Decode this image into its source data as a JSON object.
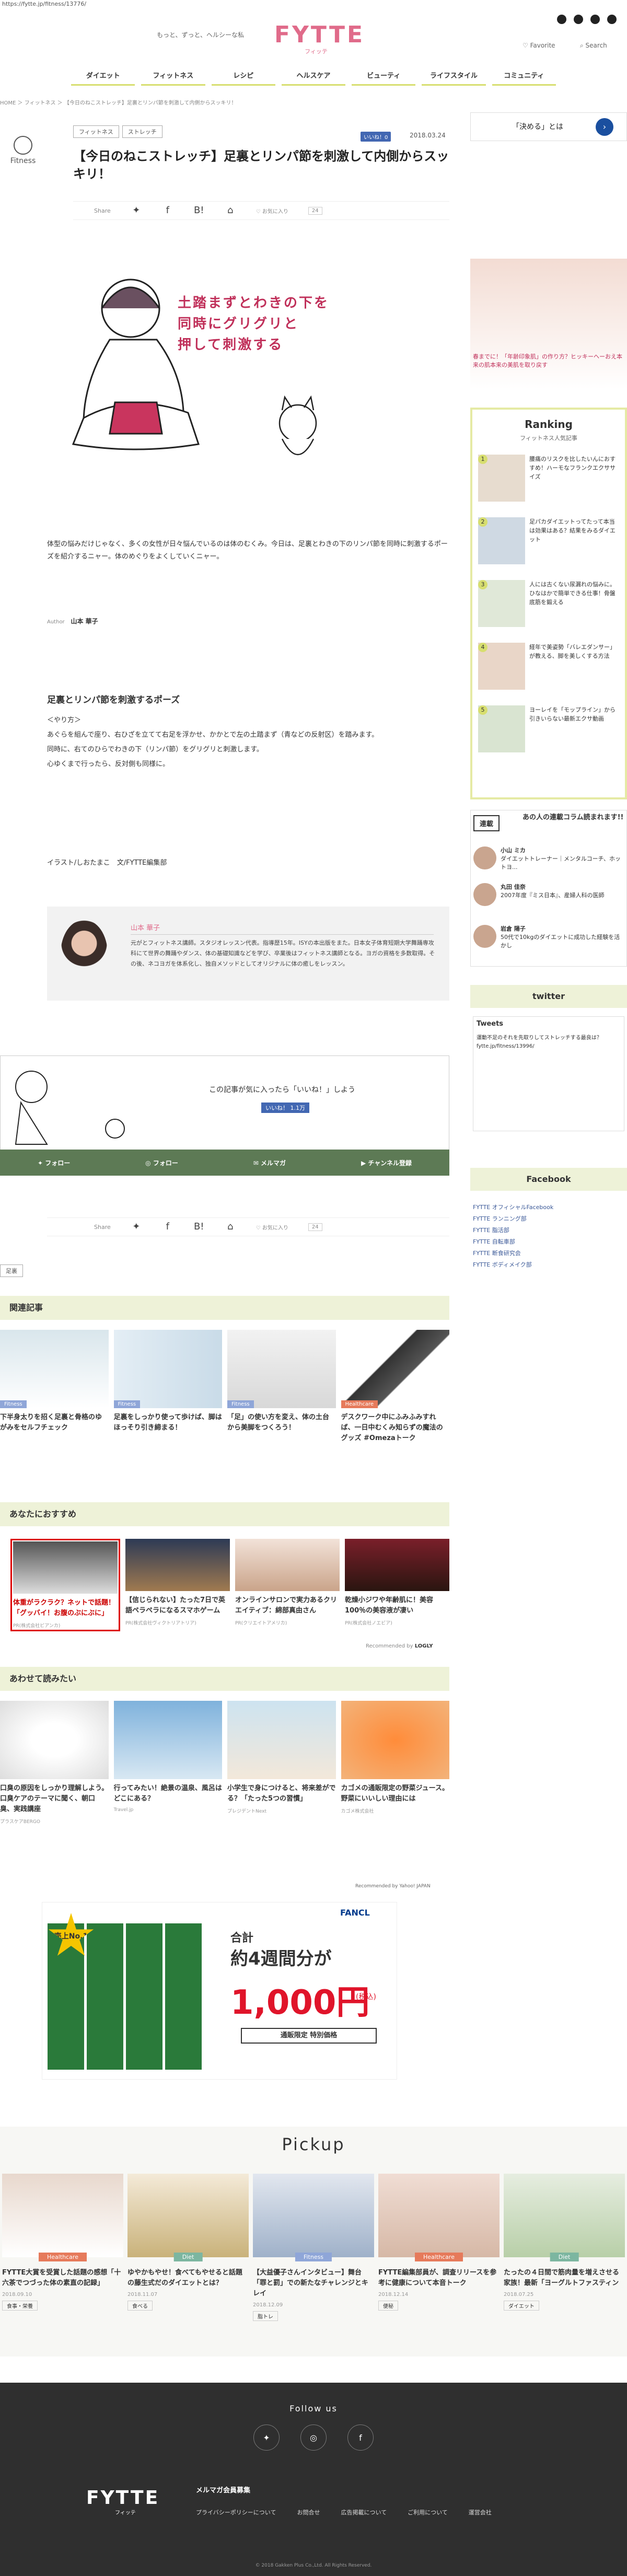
{
  "browser": {
    "url": "https://fytte.jp/fitness/13776/"
  },
  "header": {
    "tagline": "もっと、ずっと、ヘルシーな私",
    "logo": "FYTTE",
    "logo_sub": "フィッテ",
    "favorite": "Favorite",
    "search": "Search",
    "nav": [
      "ダイエット",
      "フィットネス",
      "レシピ",
      "ヘルスケア",
      "ビューティ",
      "ライフスタイル",
      "コミュニティ"
    ]
  },
  "breadcrumb": "HOME ＞ フィットネス ＞ 【今日のねこストレッチ】足裏とリンパ節を刺激して内側からスッキリ！",
  "article": {
    "category_label": "Fitness",
    "tags": [
      "フィットネス",
      "ストレッチ"
    ],
    "like_label": "いいね！0",
    "date": "2018.03.24",
    "title": "【今日のねこストレッチ】足裏とリンパ節を刺激して内側からスッキリ！",
    "share_label": "Share",
    "save_label": "お気に入り",
    "save_count": "24",
    "hero_text": [
      "土踏まずとわきの下を",
      "同時にグリグリと",
      "押して刺激する"
    ],
    "intro": "体型の悩みだけじゃなく、多くの女性が日々悩んでいるのは体のむくみ。今日は、足裏とわきの下のリンパ節を同時に刺激するポーズを紹介するニャー。体のめぐりをよくしていくニャー。",
    "author_label": "Author",
    "author_name": "山本 華子",
    "section_title": "足裏とリンパ節を刺激するポーズ",
    "method_title": "＜やり方＞",
    "method": [
      "あぐらを組んで座り、右ひざを立てて右足を浮かせ、かかとで左の土踏まず（青などの反射区）を踏みます。",
      "同時に、右てのひらでわきの下（リンパ節）をグリグリと刺激します。",
      "心ゆくまで行ったら、反対側も同様に。"
    ],
    "credit": "イラスト/しおたまこ　文/FYTTE編集部",
    "writer_name": "山本 華子",
    "writer_desc": "元がとフィットネス講師。スタジオレッスン代表。指導歴15年。ISYの本出版をまた。日本女子体育短期大学舞踊専攻科にて世界の舞踊やダンス、体の基礎知識などを学び、卒業後はフィットネス講師となる。ヨガの資格を多数取得。その後、ネコヨガを体系化し、独自メソッドとしてオリジナルに体の癒しをレッスン。"
  },
  "cta": {
    "message": "この記事が気に入ったら「いいね！」しよう",
    "like": "いいね！ 1.1万",
    "bar": [
      "フォロー",
      "フォロー",
      "メルマガ",
      "チャンネル登録"
    ]
  },
  "tag_bottom": "足裏",
  "related": {
    "title": "関連記事",
    "items": [
      {
        "badge": "Fitness",
        "title": "下半身太りを招く足裏と骨格のゆがみをセルフチェック"
      },
      {
        "badge": "Fitness",
        "title": "足裏をしっかり使って歩けば、脚はほっそり引き締まる！"
      },
      {
        "badge": "Fitness",
        "title": "「足」の使い方を変え、体の土台から美脚をつくろう！"
      },
      {
        "badge": "Healthcare",
        "title": "デスクワーク中にふみふみすれば、一日中むくみ知らずの魔法のグッズ #Omezaトーク"
      }
    ]
  },
  "recommend": {
    "title": "あなたにおすすめ",
    "items": [
      {
        "title": "体重がラクラク？ネットで話題！「グッバイ！お腹のぶにぶに」",
        "src": "PR(株式会社ビアンカ)"
      },
      {
        "title": "【信じられない】たった7日で英語ペラペラになるスマホゲーム",
        "src": "PR(株式会社ヴィクトリアトリア)"
      },
      {
        "title": "オンラインサロンで実力あるクリエイティブ：綿部真由さん",
        "src": "PR(クリエイトアメリカ)"
      },
      {
        "title": "乾燥小ジワや年齢肌に！美容100％の美容液が凄い",
        "src": "PR(株式会社ノエビア)"
      }
    ],
    "powered": "Recommended by",
    "powered_brand": "LOGLY"
  },
  "also": {
    "title": "あわせて読みたい",
    "items": [
      {
        "title": "口臭の原因をしっかり理解しよう。口臭ケアのテーマに聞く、朝口臭、実践講座",
        "src": "プラスケアBERGO"
      },
      {
        "title": "行ってみたい！絶景の温泉、風呂はどこにある？",
        "src": "Travel.jp"
      },
      {
        "title": "小学生で身につけると、将来差がでる？「たった5つの習慣」",
        "src": "プレジデントNext"
      },
      {
        "title": "カゴメの通販限定の野菜ジュース。野菜にいいしい理由には",
        "src": "カゴメ株式会社"
      }
    ],
    "powered": "Recommended by Yahoo! JAPAN"
  },
  "banner": {
    "brand": "FANCL",
    "line1": "合計",
    "line2": "約4週間分が",
    "price": "1,000円",
    "tax": "(税込)",
    "note": "通販限定 特別価格",
    "badge": "売上No.1"
  },
  "pickup": {
    "title": "Pickup",
    "items": [
      {
        "badge": "Healthcare",
        "title": "FYTTE大賞を受賞した話題の感想「十六茶でつづった体の素直の記録」",
        "date": "2018.09.10",
        "tag": "食事・栄養"
      },
      {
        "badge": "Diet",
        "title": "ゆやかもやせ！食べてもやせると話題の藤生式だのダイエットとは？",
        "date": "2018.11.07",
        "tag": "食べる"
      },
      {
        "badge": "Fitness",
        "title": "【大益優子さんインタビュー】舞台「罪と罰」での新たなチャレンジとキレイ",
        "date": "2018.12.09",
        "tag": "脂トレ"
      },
      {
        "badge": "Healthcare",
        "title": "FYTTE編集部員が、調査リリースを参考に健康について本音トーク",
        "date": "2018.12.14",
        "tag": "便秘"
      },
      {
        "badge": "Diet",
        "title": "たったの４日間で筋肉量を増えさせる家族！最新「ヨーグルトファスティン",
        "date": "2018.07.25",
        "tag": "ダイエット"
      }
    ]
  },
  "sidebar": {
    "ad1_text": "「決める」とは",
    "ad2_text": "春までに！「年齢印象肌」の作り方？ヒッキーヘーおえ本来の肌本来の美肌を取り戻す",
    "ranking_title": "Ranking",
    "ranking_sub": "フィットネス人気記事",
    "ranking": [
      {
        "n": "1",
        "t": "腰痛のリスクを比したいんにおすすめ！ハーモなフランクエクササイズ"
      },
      {
        "n": "2",
        "t": "足パカダイエットってたって本当は効果はある？結果をみるダイエット"
      },
      {
        "n": "3",
        "t": "人には古くない尿漏れの悩みに。ひなはかで簡単できる仕事！骨盤底筋を鍛える"
      },
      {
        "n": "4",
        "t": "経年で美姿勢「バレエダンサー」が教える、脚を美しくする方法"
      },
      {
        "n": "5",
        "t": "ヨーレイを「モップライン」から引きいらない最新エクサ動画"
      }
    ],
    "serial_badge": "連載",
    "serial_head": "あの人の連載コラム読まれます!!",
    "serial": [
      {
        "name": "小山 ミカ",
        "desc": "ダイエットトレーナー｜メンタルコーチ、ホットヨ..."
      },
      {
        "name": "丸田 佳奈",
        "desc": "2007年度『ミス日本』、産婦人科の医師"
      },
      {
        "name": "岩倉 陽子",
        "desc": "50代で10kgのダイエットに成功した経験を活かし"
      }
    ],
    "twitter_title": "twitter",
    "tweets_label": "Tweets",
    "tweet_text": "運動不足のそれを先取りしてストレッチする最良は？ fytte.jp/fitness/13996/",
    "facebook_title": "Facebook",
    "fb_links": [
      "FYTTE オフィシャルFacebook",
      "FYTTE ランニング部",
      "FYTTE 脂活部",
      "FYTTE 自転車部",
      "FYTTE 断食研究会",
      "FYTTE ボディメイク部"
    ]
  },
  "footer": {
    "follow": "Follow us",
    "logo": "FYTTE",
    "logo_sub": "フィッテ",
    "mail": "メルマガ会員募集",
    "links": [
      "プライバシーポリシーについて",
      "お問合せ",
      "広告掲載について",
      "ご利用について",
      "運営会社"
    ],
    "copyright": "© 2018 Gakken Plus Co.,Ltd. All Rights Reserved."
  },
  "colors": {
    "accent": "#d7de6f",
    "brand": "#e06b8a",
    "band": "#eef2d8",
    "facebook": "#4267b2",
    "healthcare_badge": "#e67a5b",
    "fitness_badge": "#8fa6d8",
    "diet_badge": "#7cb6a0"
  }
}
